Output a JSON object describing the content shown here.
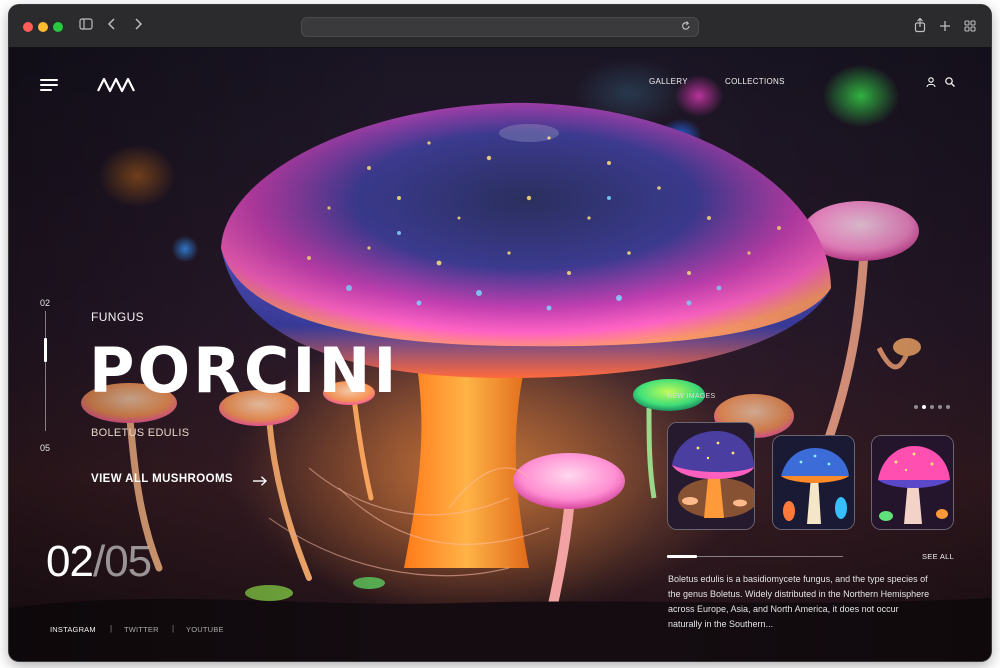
{
  "browser": {
    "address_value": "",
    "icons": [
      "sidebar-icon",
      "back-icon",
      "forward-icon",
      "reload-icon",
      "share-icon",
      "new-tab-icon",
      "tab-overview-icon"
    ]
  },
  "nav": {
    "links": [
      "GALLERY",
      "COLLECTIONS"
    ],
    "icons": [
      "menu-icon",
      "logo",
      "user-icon",
      "search-icon"
    ]
  },
  "slider": {
    "rail_start": "02",
    "rail_end": "05",
    "current": "02",
    "separator": "/",
    "total": "05",
    "dots_total": 5,
    "dots_active_index": 1
  },
  "hero": {
    "eyebrow": "FUNGUS",
    "title": "PORCINI",
    "subtitle": "BOLETUS EDULIS",
    "cta_label": "VIEW ALL MUSHROOMS"
  },
  "social": [
    "INSTAGRAM",
    "TWITTER",
    "YOUTUBE"
  ],
  "social_separator": "|",
  "new_images": {
    "label": "NEW IMAGES",
    "see_all": "SEE ALL",
    "progress_fraction": 0.17,
    "description": "Boletus edulis is a basidiomycete fungus, and the type species of the genus Boletus. Widely distributed in the Northern Hemisphere across Europe, Asia, and North America, it does not occur naturally in the Southern..."
  },
  "colors": {
    "accent": "#ffffff",
    "subtitle": "#e8d6c8",
    "cap_pink": "#ff4fb8",
    "cap_blue": "#3a58ff",
    "stem_orange": "#f08a24"
  }
}
